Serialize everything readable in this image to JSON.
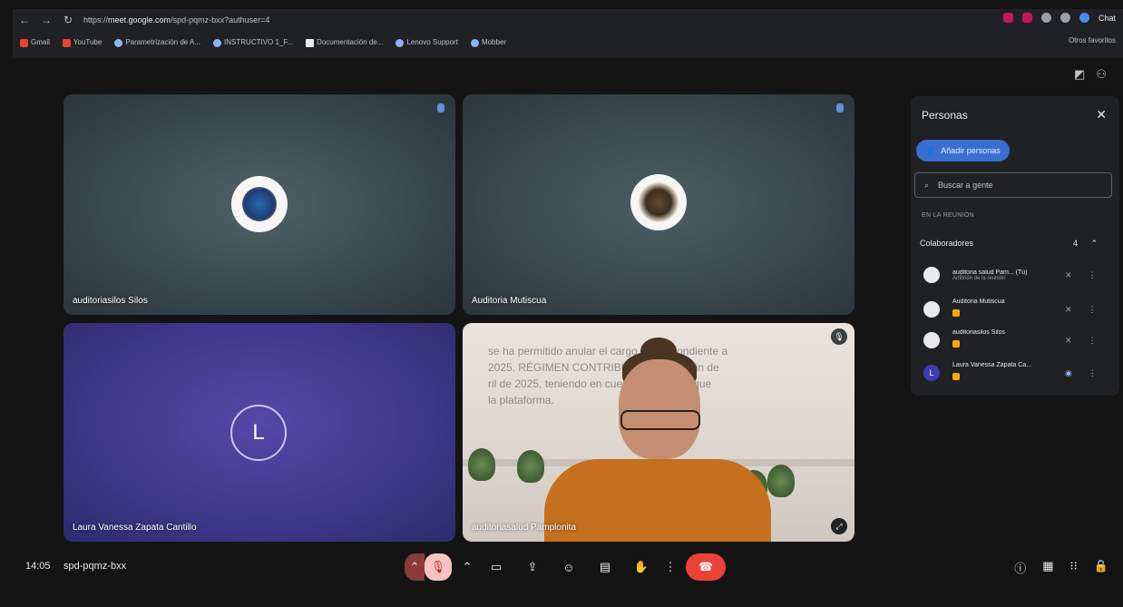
{
  "browser": {
    "url_prefix": "https://",
    "url_host": "meet.google.com",
    "url_path": "/spd-pqmz-bxx?authuser=4",
    "profile_label": "Chat",
    "bookmarks": [
      "Gmail",
      "YouTube",
      "Parametrización de A...",
      "INSTRUCTIVO 1_F...",
      "Documentación de...",
      "Lenovo Support",
      "Mobber"
    ],
    "all_bookmarks": "Otros favoritos"
  },
  "tiles": [
    {
      "name": "auditoriasilos Silos"
    },
    {
      "name": "Auditoria Mutiscua"
    },
    {
      "name": "Laura Vanessa Zapata Cantillo",
      "initial": "L"
    },
    {
      "name": "auditoriasalud Pamplonita"
    }
  ],
  "overlay_lines": [
    "se ha permitido anular el cargo correspondiente a",
    "2025. RÉGIMEN CONTRIBUTIVO, con el fin de",
    "ril de 2025, teniendo en cuenta las demás que",
    "la plataforma."
  ],
  "meeting": {
    "time": "14:05",
    "code": "spd-pqmz-bxx"
  },
  "panel": {
    "title": "Personas",
    "add_label": "Añadir personas",
    "search_placeholder": "Buscar a gente",
    "section_label": "EN LA REUNIÓN",
    "group_label": "Colaboradores",
    "group_count": "4",
    "people": [
      {
        "name": "auditoria salud Pam...",
        "sub": "Anfitrión de la reunión",
        "tag": "(Tú)"
      },
      {
        "name": "Auditoria Mutiscua",
        "sub": ""
      },
      {
        "name": "auditoriasilos Silos",
        "sub": ""
      },
      {
        "name": "Laura Vanessa Zapata Ca...",
        "sub": "",
        "initial": "L"
      }
    ]
  },
  "icons": {
    "close": "close-icon",
    "add_person": "person-add-icon",
    "search": "search-icon",
    "mic_off": "mic-off-icon",
    "camera": "camera-icon",
    "present": "present-icon",
    "emoji": "emoji-icon",
    "captions": "captions-icon",
    "hand": "raise-hand-icon",
    "more": "more-icon",
    "end_call": "end-call-icon",
    "info": "info-icon",
    "chat": "chat-icon",
    "activities": "activities-icon",
    "host": "host-controls-icon"
  },
  "colors": {
    "end_call": "#ea4335",
    "mic_off_bg": "#f6c3c0",
    "add_people_bg": "#3a6fd0",
    "participant_tile": "#41388c"
  }
}
